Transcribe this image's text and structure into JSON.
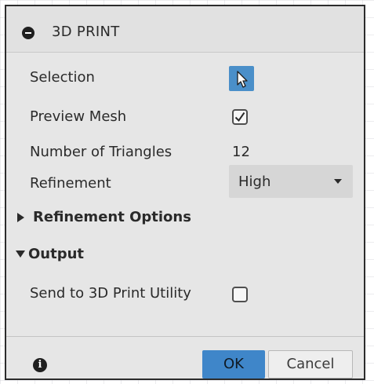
{
  "title": "3D PRINT",
  "rows": {
    "selection": {
      "label": "Selection"
    },
    "preview_mesh": {
      "label": "Preview Mesh",
      "checked": true
    },
    "triangles": {
      "label": "Number of Triangles",
      "value": "12"
    },
    "refinement": {
      "label": "Refinement",
      "value": "High"
    }
  },
  "sections": {
    "refinement_options": {
      "label": "Refinement Options",
      "expanded": false
    },
    "output": {
      "label": "Output",
      "expanded": true
    }
  },
  "send_to_utility": {
    "label": "Send to 3D Print Utility",
    "checked": false
  },
  "footer": {
    "ok_label": "OK",
    "cancel_label": "Cancel"
  },
  "icons": {
    "collapse": "minus-circle-icon",
    "selection": "cursor-arrow-icon",
    "info": "info-icon",
    "dropdown": "chevron-down-icon"
  },
  "colors": {
    "accent": "#3f86c9",
    "panel": "#e6e6e6"
  }
}
